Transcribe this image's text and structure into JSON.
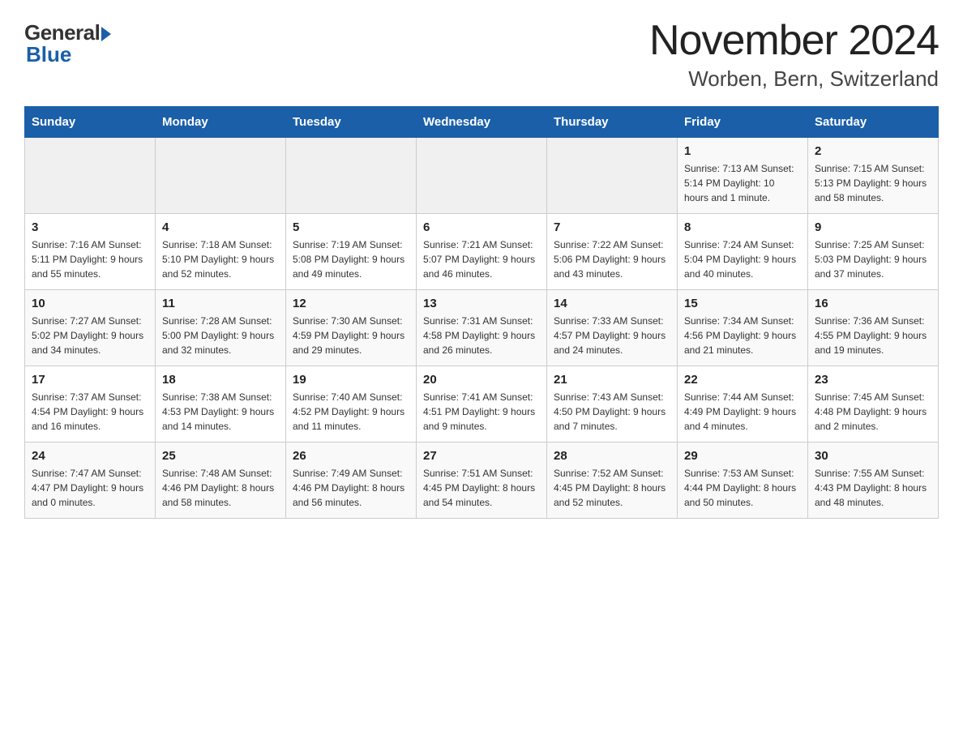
{
  "header": {
    "logo_general": "General",
    "logo_blue": "Blue",
    "month_title": "November 2024",
    "location": "Worben, Bern, Switzerland"
  },
  "days_of_week": [
    "Sunday",
    "Monday",
    "Tuesday",
    "Wednesday",
    "Thursday",
    "Friday",
    "Saturday"
  ],
  "weeks": [
    [
      {
        "day": "",
        "info": ""
      },
      {
        "day": "",
        "info": ""
      },
      {
        "day": "",
        "info": ""
      },
      {
        "day": "",
        "info": ""
      },
      {
        "day": "",
        "info": ""
      },
      {
        "day": "1",
        "info": "Sunrise: 7:13 AM\nSunset: 5:14 PM\nDaylight: 10 hours and 1 minute."
      },
      {
        "day": "2",
        "info": "Sunrise: 7:15 AM\nSunset: 5:13 PM\nDaylight: 9 hours and 58 minutes."
      }
    ],
    [
      {
        "day": "3",
        "info": "Sunrise: 7:16 AM\nSunset: 5:11 PM\nDaylight: 9 hours and 55 minutes."
      },
      {
        "day": "4",
        "info": "Sunrise: 7:18 AM\nSunset: 5:10 PM\nDaylight: 9 hours and 52 minutes."
      },
      {
        "day": "5",
        "info": "Sunrise: 7:19 AM\nSunset: 5:08 PM\nDaylight: 9 hours and 49 minutes."
      },
      {
        "day": "6",
        "info": "Sunrise: 7:21 AM\nSunset: 5:07 PM\nDaylight: 9 hours and 46 minutes."
      },
      {
        "day": "7",
        "info": "Sunrise: 7:22 AM\nSunset: 5:06 PM\nDaylight: 9 hours and 43 minutes."
      },
      {
        "day": "8",
        "info": "Sunrise: 7:24 AM\nSunset: 5:04 PM\nDaylight: 9 hours and 40 minutes."
      },
      {
        "day": "9",
        "info": "Sunrise: 7:25 AM\nSunset: 5:03 PM\nDaylight: 9 hours and 37 minutes."
      }
    ],
    [
      {
        "day": "10",
        "info": "Sunrise: 7:27 AM\nSunset: 5:02 PM\nDaylight: 9 hours and 34 minutes."
      },
      {
        "day": "11",
        "info": "Sunrise: 7:28 AM\nSunset: 5:00 PM\nDaylight: 9 hours and 32 minutes."
      },
      {
        "day": "12",
        "info": "Sunrise: 7:30 AM\nSunset: 4:59 PM\nDaylight: 9 hours and 29 minutes."
      },
      {
        "day": "13",
        "info": "Sunrise: 7:31 AM\nSunset: 4:58 PM\nDaylight: 9 hours and 26 minutes."
      },
      {
        "day": "14",
        "info": "Sunrise: 7:33 AM\nSunset: 4:57 PM\nDaylight: 9 hours and 24 minutes."
      },
      {
        "day": "15",
        "info": "Sunrise: 7:34 AM\nSunset: 4:56 PM\nDaylight: 9 hours and 21 minutes."
      },
      {
        "day": "16",
        "info": "Sunrise: 7:36 AM\nSunset: 4:55 PM\nDaylight: 9 hours and 19 minutes."
      }
    ],
    [
      {
        "day": "17",
        "info": "Sunrise: 7:37 AM\nSunset: 4:54 PM\nDaylight: 9 hours and 16 minutes."
      },
      {
        "day": "18",
        "info": "Sunrise: 7:38 AM\nSunset: 4:53 PM\nDaylight: 9 hours and 14 minutes."
      },
      {
        "day": "19",
        "info": "Sunrise: 7:40 AM\nSunset: 4:52 PM\nDaylight: 9 hours and 11 minutes."
      },
      {
        "day": "20",
        "info": "Sunrise: 7:41 AM\nSunset: 4:51 PM\nDaylight: 9 hours and 9 minutes."
      },
      {
        "day": "21",
        "info": "Sunrise: 7:43 AM\nSunset: 4:50 PM\nDaylight: 9 hours and 7 minutes."
      },
      {
        "day": "22",
        "info": "Sunrise: 7:44 AM\nSunset: 4:49 PM\nDaylight: 9 hours and 4 minutes."
      },
      {
        "day": "23",
        "info": "Sunrise: 7:45 AM\nSunset: 4:48 PM\nDaylight: 9 hours and 2 minutes."
      }
    ],
    [
      {
        "day": "24",
        "info": "Sunrise: 7:47 AM\nSunset: 4:47 PM\nDaylight: 9 hours and 0 minutes."
      },
      {
        "day": "25",
        "info": "Sunrise: 7:48 AM\nSunset: 4:46 PM\nDaylight: 8 hours and 58 minutes."
      },
      {
        "day": "26",
        "info": "Sunrise: 7:49 AM\nSunset: 4:46 PM\nDaylight: 8 hours and 56 minutes."
      },
      {
        "day": "27",
        "info": "Sunrise: 7:51 AM\nSunset: 4:45 PM\nDaylight: 8 hours and 54 minutes."
      },
      {
        "day": "28",
        "info": "Sunrise: 7:52 AM\nSunset: 4:45 PM\nDaylight: 8 hours and 52 minutes."
      },
      {
        "day": "29",
        "info": "Sunrise: 7:53 AM\nSunset: 4:44 PM\nDaylight: 8 hours and 50 minutes."
      },
      {
        "day": "30",
        "info": "Sunrise: 7:55 AM\nSunset: 4:43 PM\nDaylight: 8 hours and 48 minutes."
      }
    ]
  ]
}
